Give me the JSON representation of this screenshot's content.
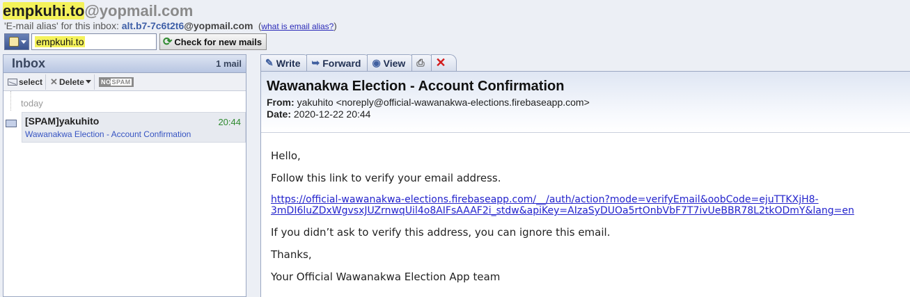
{
  "header": {
    "inbox_user": "empkuhi.to",
    "inbox_domain": "@yopmail.com",
    "alias_label": "'E-mail alias' for this inbox: ",
    "alias_user": "alt.b7-7c6t2t6",
    "alias_domain": "@yopmail.com",
    "what_is_alias_link": "what is email alias?",
    "login_value": "empkuhi.to",
    "check_button": "Check for new mails"
  },
  "inbox": {
    "title": "Inbox",
    "count": "1 mail",
    "toolbar": {
      "select_label": "select",
      "delete_label": "Delete",
      "nospam_left": "NO",
      "nospam_right": "SPAM"
    },
    "group_label": "today",
    "messages": [
      {
        "from": "[SPAM]yakuhito",
        "time": "20:44",
        "subject": "Wawanakwa Election - Account Confirmation"
      }
    ]
  },
  "reader": {
    "tabs": [
      {
        "label": "Write",
        "icon": "pencil-icon"
      },
      {
        "label": "Forward",
        "icon": "forward-icon"
      },
      {
        "label": "View",
        "icon": "eye-icon"
      },
      {
        "label": "",
        "icon": "printer-icon"
      },
      {
        "label": "",
        "icon": "delete-x-icon"
      }
    ],
    "subject": "Wawanakwa Election - Account Confirmation",
    "from_label": "From:",
    "from_value": "yakuhito <noreply@official-wawanakwa-elections.firebaseapp.com>",
    "date_label": "Date:",
    "date_value": "2020-12-22 20:44",
    "body": {
      "greeting": "Hello,",
      "instruction": "Follow this link to verify your email address.",
      "link_line1": "https://official-wawanakwa-elections.firebaseapp.com/__/auth/action?mode=verifyEmail&oobCode=ejuTTKXjH8-",
      "link_line2": "3mDI6luZDxWgvsxJUZrnwqUil4o8AIFsAAAF2i_stdw&apiKey=AIzaSyDUOa5rtOnbVbF7T7ivUeBBR78L2tkODmY&lang=en",
      "ignore_note": "If you didn’t ask to verify this address, you can ignore this email.",
      "thanks": "Thanks,",
      "signature": "Your Official Wawanakwa Election App team"
    }
  }
}
